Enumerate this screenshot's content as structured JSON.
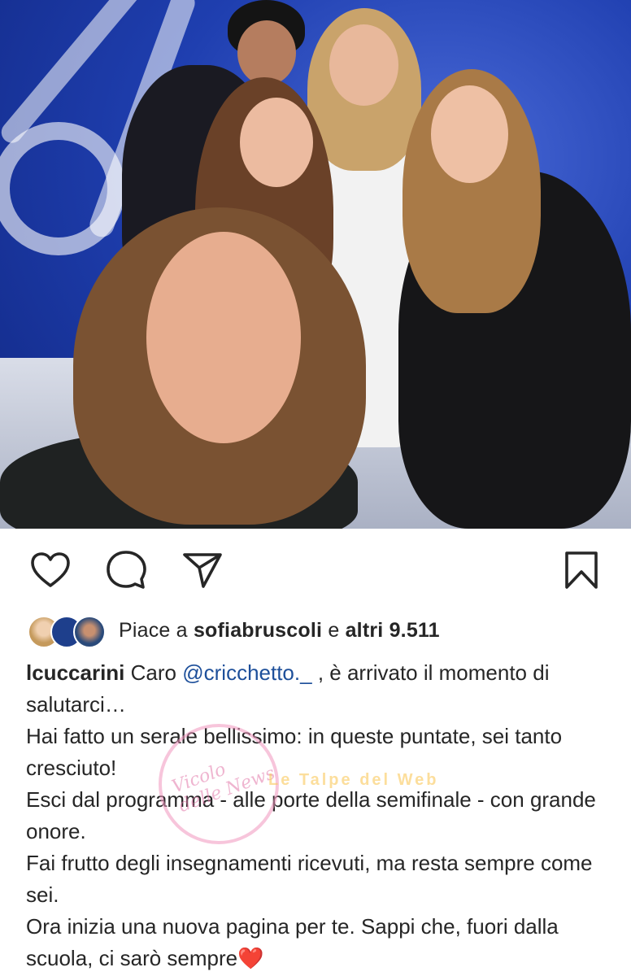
{
  "post": {
    "image_alt": "",
    "actions": {
      "like_icon": "heart-icon",
      "comment_icon": "comment-icon",
      "share_icon": "send-icon",
      "save_icon": "bookmark-icon"
    },
    "likes": {
      "prefix": "Piace a",
      "user": "sofiabruscoli",
      "middle": "e",
      "others": "altri 9.511"
    },
    "caption": {
      "username": "lcuccarini",
      "line1_a": "Caro",
      "mention": "@cricchetto._",
      "line1_b": ", è arrivato il momento di salutarci…",
      "line2": "Hai fatto un serale bellissimo: in queste puntate, sei tanto cresciuto!",
      "line3": "Esci dal programma - alle porte della semifinale - con grande onore.",
      "line4": "Fai frutto degli insegnamenti ricevuti, ma resta sempre come sei.",
      "line5": "Ora inizia una nuova pagina per te. Sappi che, fuori dalla scuola, ci sarò sempre",
      "heart_emoji": "❤️"
    },
    "watermark": {
      "text1": "Vicolo delle News",
      "text2": "Le Talpe del Web"
    }
  }
}
